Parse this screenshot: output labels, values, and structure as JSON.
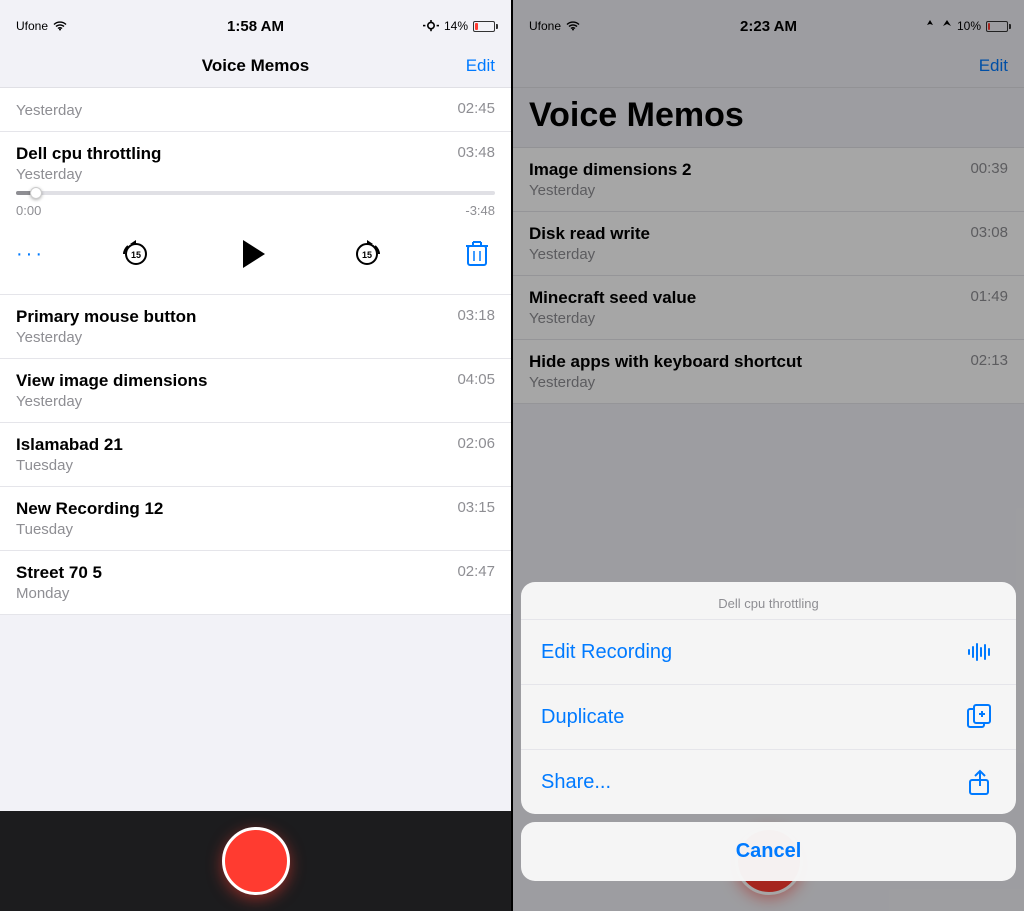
{
  "left": {
    "statusBar": {
      "carrier": "Ufone",
      "time": "1:58 AM",
      "battery": "14%"
    },
    "nav": {
      "title": "Voice Memos",
      "editLabel": "Edit"
    },
    "expandedItem": {
      "title": "Dell cpu throttling",
      "date": "Yesterday",
      "duration": "03:48",
      "timeElapsed": "0:00",
      "timeRemaining": "-3:48",
      "progressPercent": 3
    },
    "memoItems": [
      {
        "title": "Primary mouse button",
        "date": "Yesterday",
        "duration": "03:18"
      },
      {
        "title": "View image dimensions",
        "date": "Yesterday",
        "duration": "04:05"
      },
      {
        "title": "Islamabad 21",
        "date": "Tuesday",
        "duration": "02:06"
      },
      {
        "title": "New Recording 12",
        "date": "Tuesday",
        "duration": "03:15"
      },
      {
        "title": "Street 70 5",
        "date": "Monday",
        "duration": "02:47"
      }
    ]
  },
  "right": {
    "statusBar": {
      "carrier": "Ufone",
      "time": "2:23 AM",
      "battery": "10%"
    },
    "nav": {
      "editLabel": "Edit"
    },
    "header": {
      "title": "Voice Memos"
    },
    "memoItems": [
      {
        "title": "Image dimensions 2",
        "date": "Yesterday",
        "duration": "00:39"
      },
      {
        "title": "Disk read write",
        "date": "Yesterday",
        "duration": "03:08"
      },
      {
        "title": "Minecraft seed value",
        "date": "Yesterday",
        "duration": "01:49"
      },
      {
        "title": "Hide apps with keyboard shortcut",
        "date": "Yesterday",
        "duration": "02:13"
      }
    ],
    "actionSheet": {
      "recordingTitle": "Dell cpu throttling",
      "items": [
        {
          "label": "Edit Recording",
          "icon": "waveform"
        },
        {
          "label": "Duplicate",
          "icon": "duplicate"
        },
        {
          "label": "Share...",
          "icon": "share"
        }
      ],
      "cancelLabel": "Cancel"
    }
  }
}
